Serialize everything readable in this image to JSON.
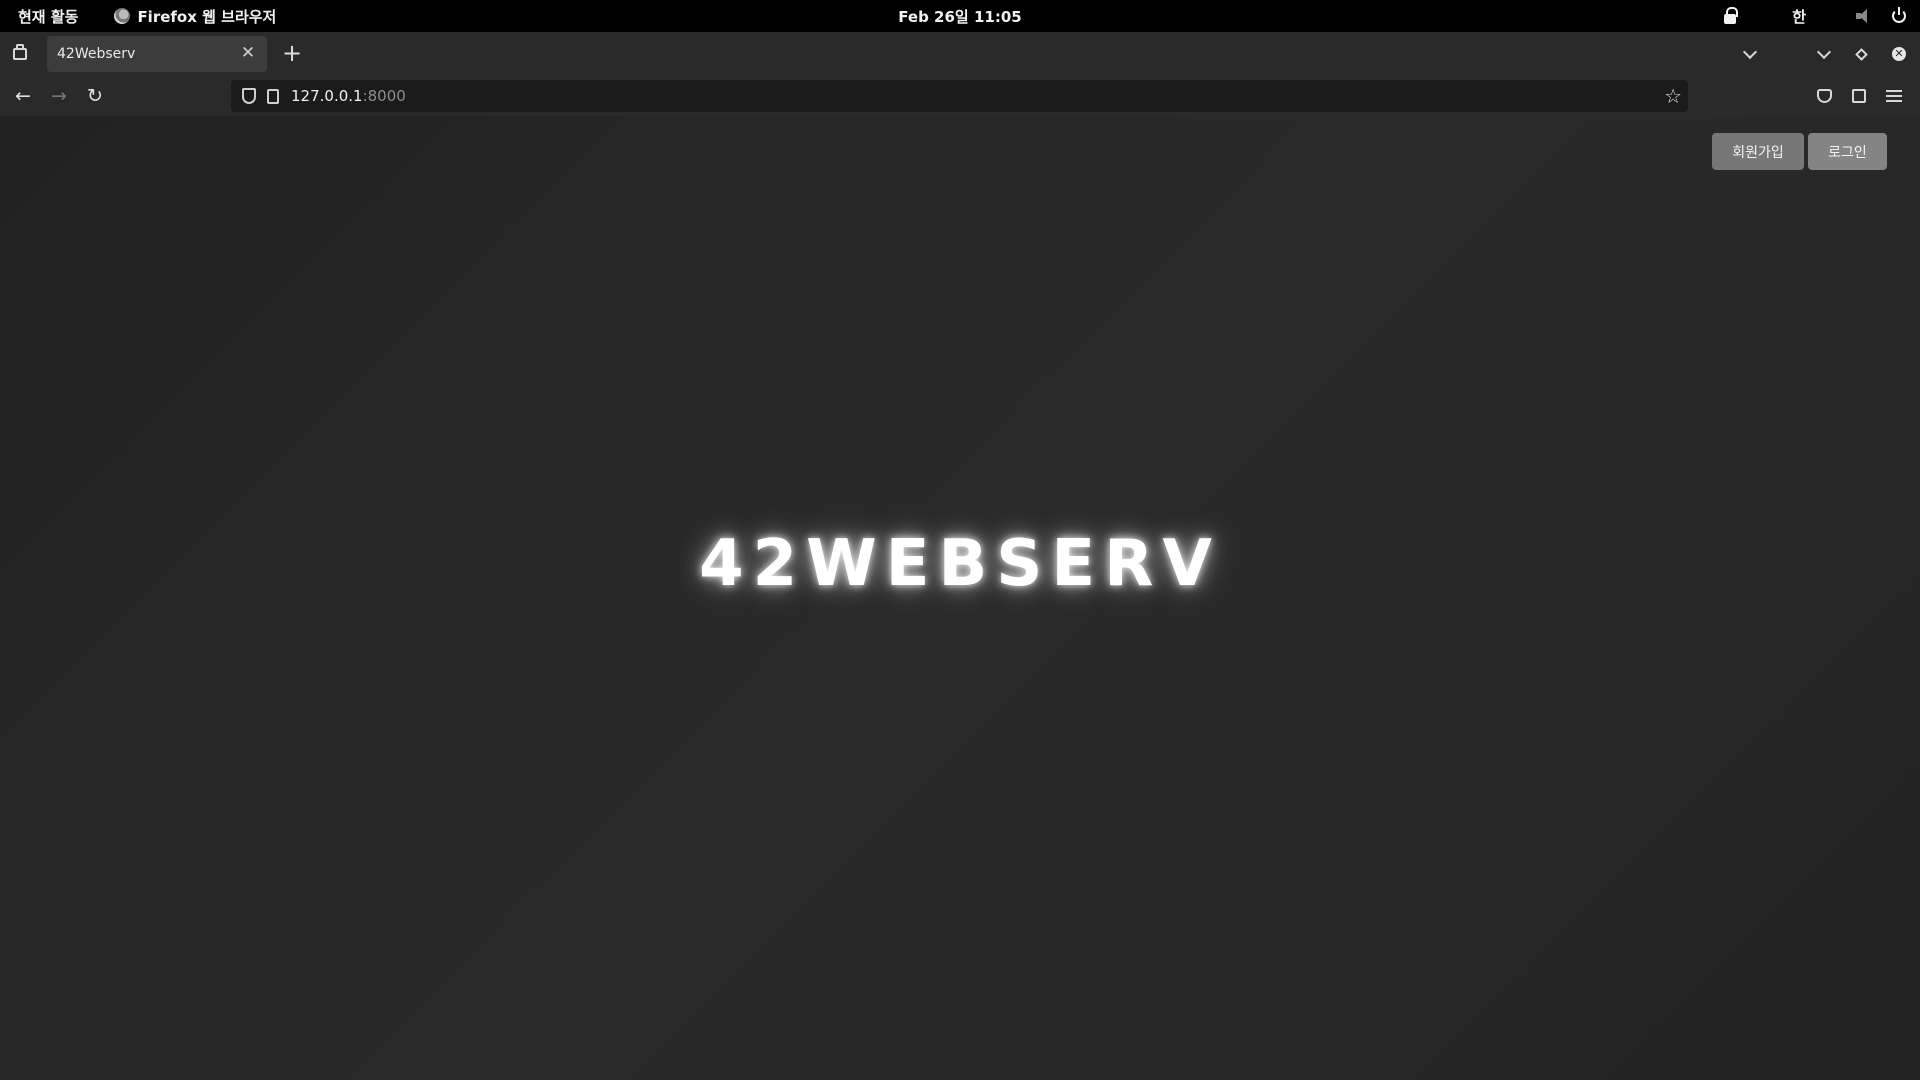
{
  "system": {
    "activities": "현재 활동",
    "app_name": "Firefox 웹 브라우저",
    "clock": "Feb 26일  11:05",
    "input_method": "한"
  },
  "browser": {
    "tab": {
      "title": "42Webserv"
    },
    "url": {
      "host": "127.0.0.1",
      "port": ":8000"
    }
  },
  "page": {
    "signup_label": "회원가입",
    "login_label": "로그인",
    "hero_title": "42WEBSERV"
  },
  "icons": {
    "tray": [
      "lock-icon",
      "volume-icon",
      "power-icon"
    ],
    "nav": [
      "back-arrow-icon",
      "forward-arrow-icon",
      "reload-icon",
      "shield-icon",
      "page-icon",
      "star-icon",
      "pocket-icon",
      "extensions-icon",
      "menu-icon"
    ]
  }
}
